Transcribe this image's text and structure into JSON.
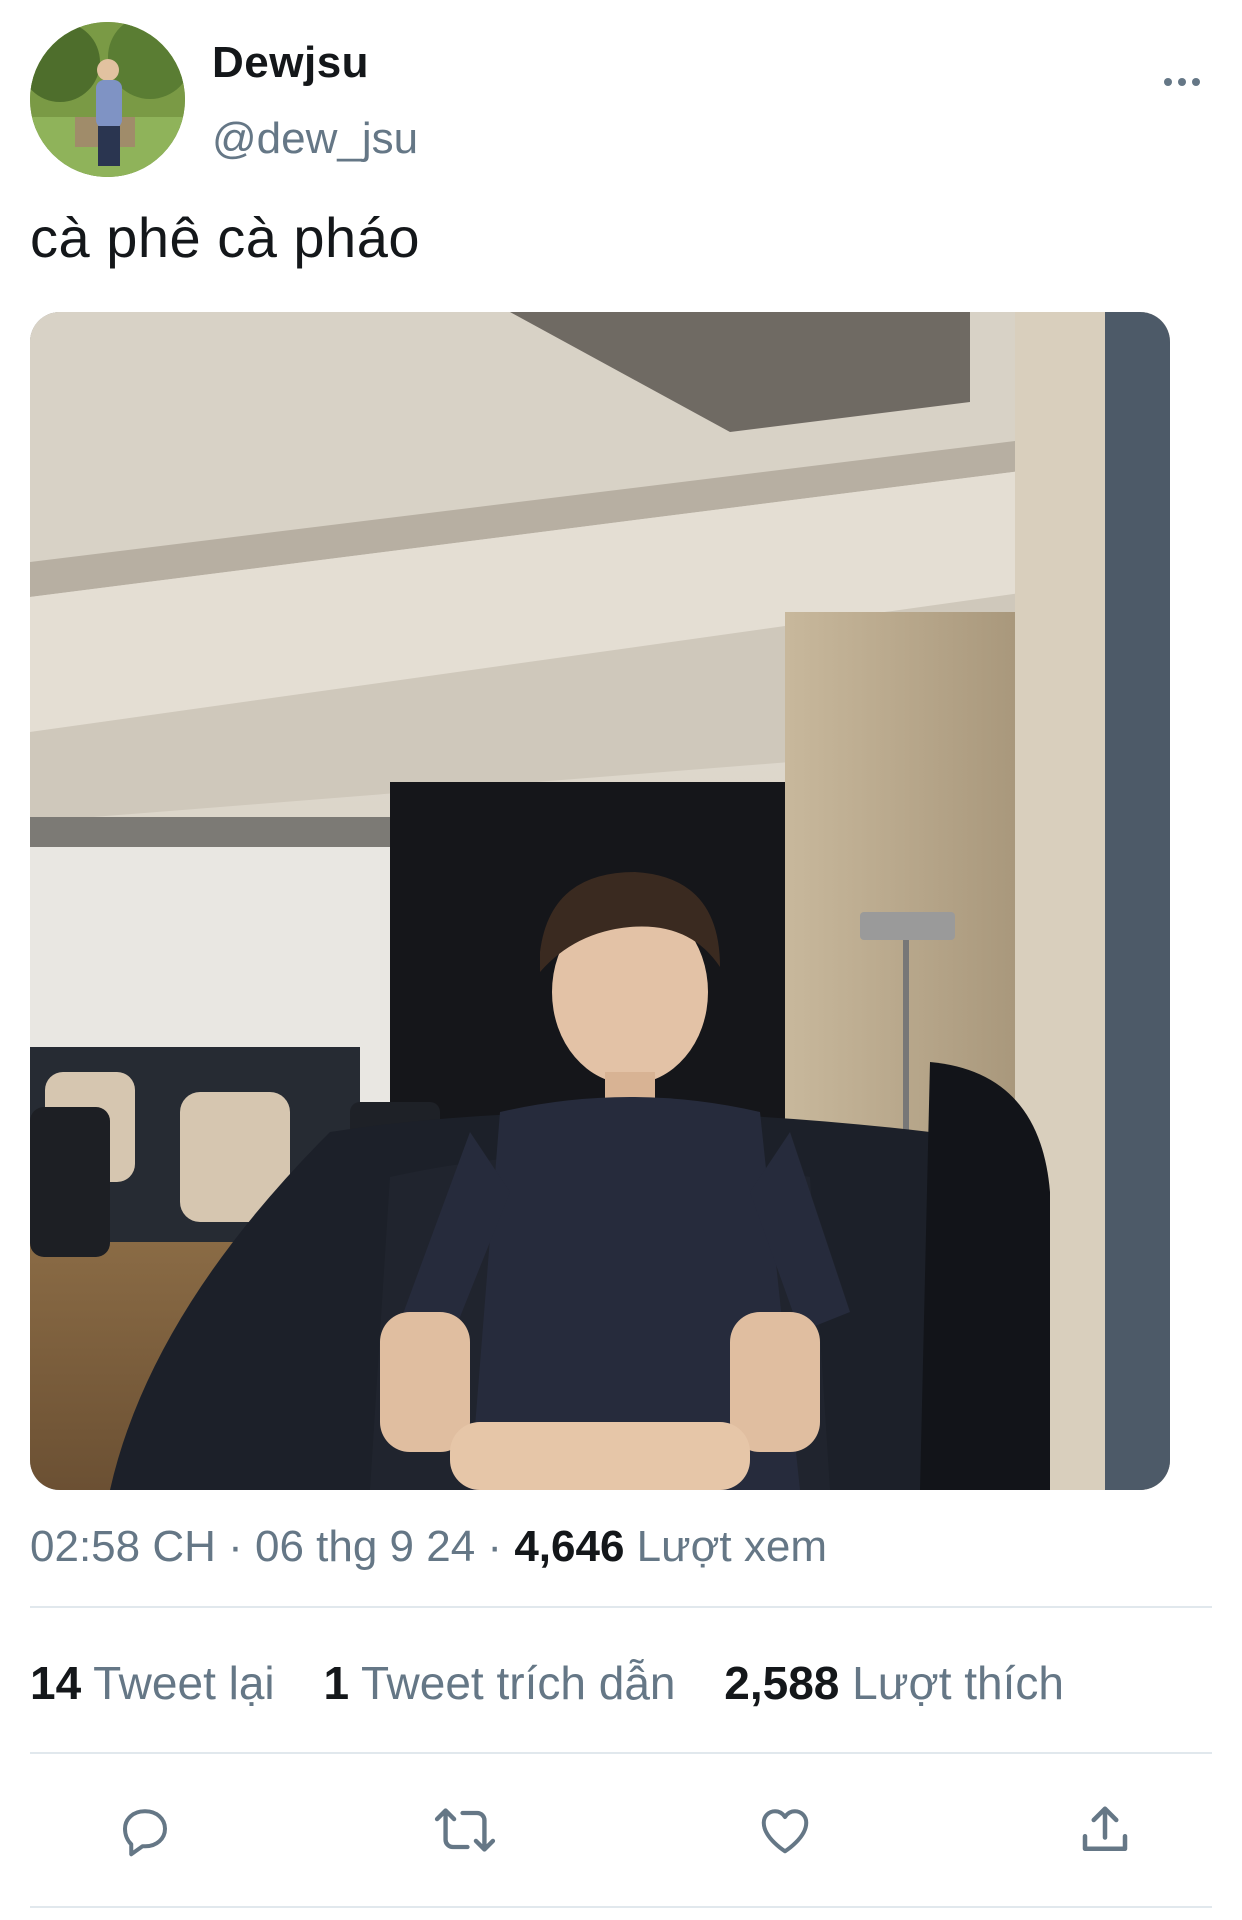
{
  "author": {
    "display_name": "Dewjsu",
    "handle": "@dew_jsu"
  },
  "tweet": {
    "text": "cà phê cà pháo"
  },
  "meta": {
    "time": "02:58 CH",
    "separator": " · ",
    "date": "06 thg 9 24",
    "views_count": "4,646",
    "views_label": "Lượt xem"
  },
  "stats": {
    "retweets_count": "14",
    "retweets_label": "Tweet lại",
    "quotes_count": "1",
    "quotes_label": "Tweet trích dẫn",
    "likes_count": "2,588",
    "likes_label": "Lượt thích"
  },
  "icons": {
    "more": "more-horizontal-icon",
    "reply": "reply-icon",
    "retweet": "retweet-icon",
    "like": "heart-icon",
    "share": "share-icon"
  },
  "colors": {
    "text_primary": "#14171a",
    "text_secondary": "#657786",
    "divider": "#e1e8ed"
  }
}
